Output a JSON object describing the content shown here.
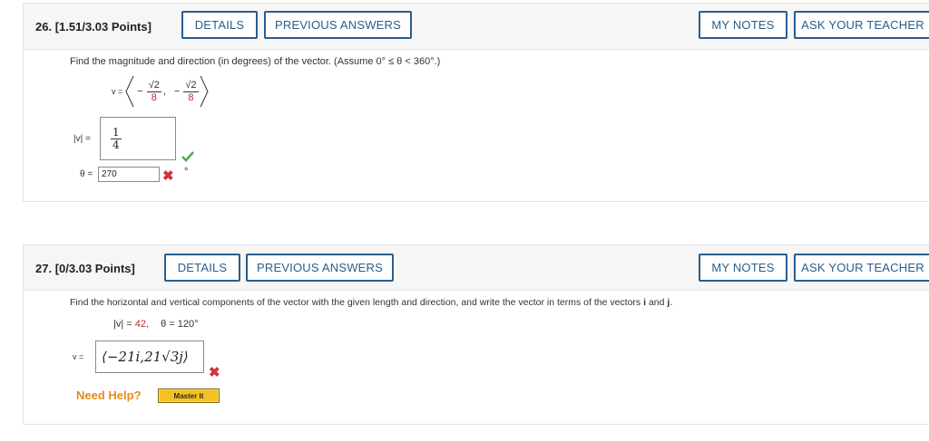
{
  "q26": {
    "number": "26.",
    "points": "[1.51/3.03 Points]",
    "details_label": "DETAILS",
    "previous_label": "PREVIOUS ANSWERS",
    "notes_label": "MY NOTES",
    "teacher_label": "ASK YOUR TEACHER",
    "prompt": "Find the magnitude and direction (in degrees) of the vector. (Assume 0° ≤ θ < 360°.)",
    "vector_lhs": "v =",
    "comp1_sign": "−",
    "comp1_num": "√2",
    "comp1_den": "8",
    "comp2_sign": "−",
    "comp2_num": "√2",
    "comp2_den": "8",
    "mag_label": "|v| =",
    "mag_num": "1",
    "mag_den": "4",
    "mag_status": "correct",
    "theta_label": "θ =",
    "theta_value": "270",
    "theta_status": "incorrect",
    "theta_unit": "°"
  },
  "q27": {
    "number": "27.",
    "points": "[0/3.03 Points]",
    "details_label": "DETAILS",
    "previous_label": "PREVIOUS ANSWERS",
    "notes_label": "MY NOTES",
    "teacher_label": "ASK YOUR TEACHER",
    "prompt": "Find the horizontal and vertical components of the vector with the given length and direction, and write the vector in terms of the vectors",
    "prompt_i": "i",
    "prompt_and": "and",
    "prompt_j": "j",
    "prompt_end": ".",
    "given_mag_label": "|v| =",
    "given_mag_value": "42,",
    "given_theta_label": "θ = 120°",
    "answer_lhs": "v =",
    "answer_value": "⟨−21i,21√3j⟩",
    "answer_status": "incorrect",
    "help_label": "Need Help?",
    "master_label": "Master It"
  },
  "colors": {
    "button_border": "#2a5d8c",
    "red_value": "#c1272d",
    "incorrect_mark": "#d0333a",
    "correct_mark": "#4caf50",
    "help": "#e88a1a"
  }
}
